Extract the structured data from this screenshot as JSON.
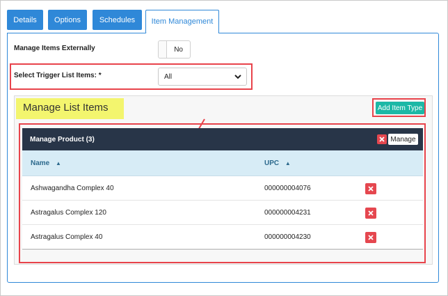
{
  "tabs": [
    {
      "label": "Details",
      "active": false
    },
    {
      "label": "Options",
      "active": false
    },
    {
      "label": "Schedules",
      "active": false
    },
    {
      "label": "Item Management",
      "active": true
    }
  ],
  "form": {
    "manage_items_externally_label": "Manage Items Externally",
    "toggle_value": "No",
    "trigger_list_label": "Select Trigger List Items: *",
    "trigger_list_value": "All"
  },
  "manage_list": {
    "title": "Manage List Items",
    "add_button": "Add Item Type"
  },
  "product_card": {
    "title": "Manage Product (3)",
    "manage_button": "Manage",
    "columns": [
      "Name",
      "UPC"
    ],
    "rows": [
      {
        "name": "Ashwagandha Complex 40",
        "upc": "000000004076"
      },
      {
        "name": "Astragalus Complex 120",
        "upc": "000000004231"
      },
      {
        "name": "Astragalus Complex 40",
        "upc": "000000004230"
      }
    ]
  },
  "colors": {
    "tab_blue": "#2f88d8",
    "highlight_red": "#e8434b",
    "teal_button": "#1cb8a6",
    "card_header": "#283548",
    "delete_red": "#e5474f",
    "yellow_highlight": "#f3f56e"
  }
}
